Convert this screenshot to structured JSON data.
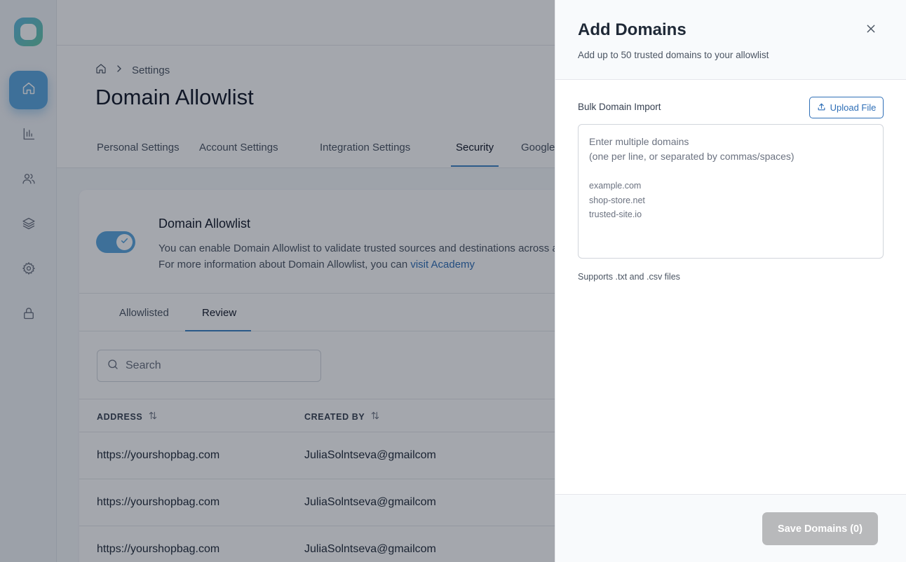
{
  "sidebar": {
    "logo": "app-logo",
    "items": [
      {
        "icon": "home-icon",
        "active": true
      },
      {
        "icon": "bar-chart-icon",
        "active": false
      },
      {
        "icon": "users-icon",
        "active": false
      },
      {
        "icon": "layers-icon",
        "active": false
      },
      {
        "icon": "gear-icon",
        "active": false
      },
      {
        "icon": "lock-icon",
        "active": false
      }
    ]
  },
  "breadcrumb": {
    "home_icon": "home-icon",
    "separator_icon": "chevron-right-icon",
    "current": "Settings"
  },
  "page": {
    "title": "Domain Allowlist"
  },
  "settings_tabs": [
    {
      "label": "Personal Settings",
      "active": false
    },
    {
      "label": "Account Settings",
      "active": false
    },
    {
      "label": "Integration Settings",
      "active": false
    },
    {
      "label": "Security",
      "active": true
    },
    {
      "label": "Google",
      "active": false
    }
  ],
  "allowlist_section": {
    "enabled": true,
    "title": "Domain Allowlist",
    "description_line1": "You can enable Domain Allowlist to validate trusted sources and destinations across all",
    "description_line2_prefix": "For more information about Domain Allowlist, you can ",
    "description_link": "visit Academy"
  },
  "sub_tabs": [
    {
      "label": "Allowlisted",
      "active": false
    },
    {
      "label": "Review",
      "active": true
    }
  ],
  "search": {
    "placeholder": "Search"
  },
  "table": {
    "columns": [
      "ADDRESS",
      "CREATED BY"
    ],
    "rows": [
      {
        "address": "https://yourshopbag.com",
        "created_by": "JuliaSolntseva@gmailcom"
      },
      {
        "address": "https://yourshopbag.com",
        "created_by": "JuliaSolntseva@gmailcom"
      },
      {
        "address": "https://yourshopbag.com",
        "created_by": "JuliaSolntseva@gmailcom"
      }
    ]
  },
  "drawer": {
    "title": "Add Domains",
    "subtitle": "Add up to 50 trusted domains to your allowlist",
    "bulk_label": "Bulk Domain Import",
    "upload_label": "Upload File",
    "textarea_placeholder": {
      "line1": "Enter multiple domains",
      "line2": "(one per line, or separated by commas/spaces)",
      "examples": [
        "example.com",
        "shop-store.net",
        "trusted-site.io"
      ]
    },
    "hint": "Supports .txt and .csv files",
    "save_label": "Save Domains (0)"
  },
  "colors": {
    "accent": "#5ba7df",
    "link": "#2f6fb7",
    "disabled_button": "#b8b9bb"
  }
}
